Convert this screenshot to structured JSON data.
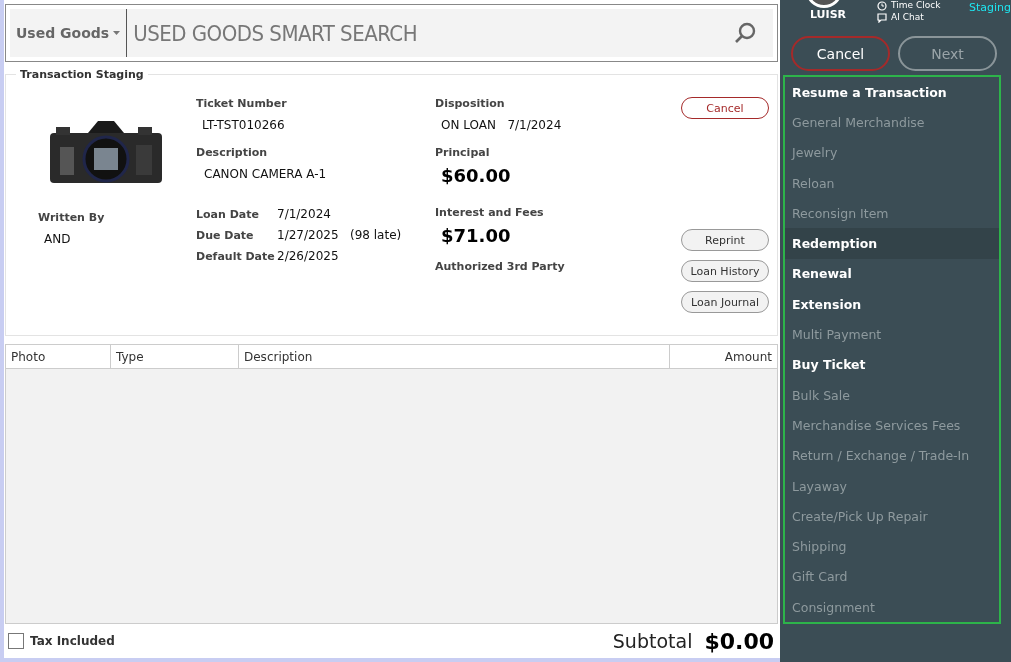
{
  "search": {
    "category": "Used Goods",
    "placeholder": "USED GOODS SMART SEARCH"
  },
  "staging": {
    "title": "Transaction Staging",
    "photo": {
      "kind": "picture"
    },
    "written_by": {
      "label": "Written By",
      "value": "AND"
    },
    "ticket_number": {
      "label": "Ticket Number",
      "value": "LT-TST010266"
    },
    "description": {
      "label": "Description",
      "value": "CANON CAMERA A-1"
    },
    "dates": [
      {
        "label": "Loan Date",
        "value": "7/1/2024"
      },
      {
        "label": "Due Date",
        "value": "1/27/2025",
        "note": "(98 late)"
      },
      {
        "label": "Default Date",
        "value": "2/26/2025"
      }
    ],
    "disposition": {
      "label": "Disposition",
      "status": "ON LOAN",
      "date": "7/1/2024"
    },
    "principal": {
      "label": "Principal",
      "value": "$60.00"
    },
    "interest": {
      "label": "Interest and Fees",
      "value": "$71.00"
    },
    "third_party": {
      "label": "Authorized 3rd Party"
    },
    "cancel_button": "Cancel",
    "buttons": [
      "Reprint",
      "Loan History",
      "Loan Journal"
    ]
  },
  "table": {
    "columns": [
      "Photo",
      "Type",
      "Description",
      "Amount"
    ]
  },
  "footer": {
    "tax_included": {
      "label": "Tax Included",
      "checked": false
    },
    "subtotal_label": "Subtotal",
    "subtotal": "$0.00"
  },
  "sidebar": {
    "user": "LUISR",
    "links": [
      {
        "kind": "clock",
        "label": "Time Clock"
      },
      {
        "kind": "chat",
        "label": "AI Chat"
      }
    ],
    "environment": "Staging",
    "cancel": "Cancel",
    "next": {
      "label": "Next",
      "disabled": true
    },
    "items": [
      {
        "label": "Resume a Transaction",
        "disabled": false,
        "selected": false
      },
      {
        "label": "General Merchandise",
        "disabled": true,
        "selected": false
      },
      {
        "label": "Jewelry",
        "disabled": true,
        "selected": false
      },
      {
        "label": "Reloan",
        "disabled": true,
        "selected": false
      },
      {
        "label": "Reconsign Item",
        "disabled": true,
        "selected": false
      },
      {
        "label": "Redemption",
        "disabled": false,
        "selected": true
      },
      {
        "label": "Renewal",
        "disabled": false,
        "selected": false
      },
      {
        "label": "Extension",
        "disabled": false,
        "selected": false
      },
      {
        "label": "Multi Payment",
        "disabled": true,
        "selected": false
      },
      {
        "label": "Buy Ticket",
        "disabled": false,
        "selected": false
      },
      {
        "label": "Bulk Sale",
        "disabled": true,
        "selected": false
      },
      {
        "label": "Merchandise Services Fees",
        "disabled": true,
        "selected": false
      },
      {
        "label": "Return / Exchange / Trade-In",
        "disabled": true,
        "selected": false
      },
      {
        "label": "Layaway",
        "disabled": true,
        "selected": false
      },
      {
        "label": "Create/Pick Up Repair",
        "disabled": true,
        "selected": false
      },
      {
        "label": "Shipping",
        "disabled": true,
        "selected": false
      },
      {
        "label": "Gift Card",
        "disabled": true,
        "selected": false
      },
      {
        "label": "Consignment",
        "disabled": true,
        "selected": false
      }
    ]
  }
}
